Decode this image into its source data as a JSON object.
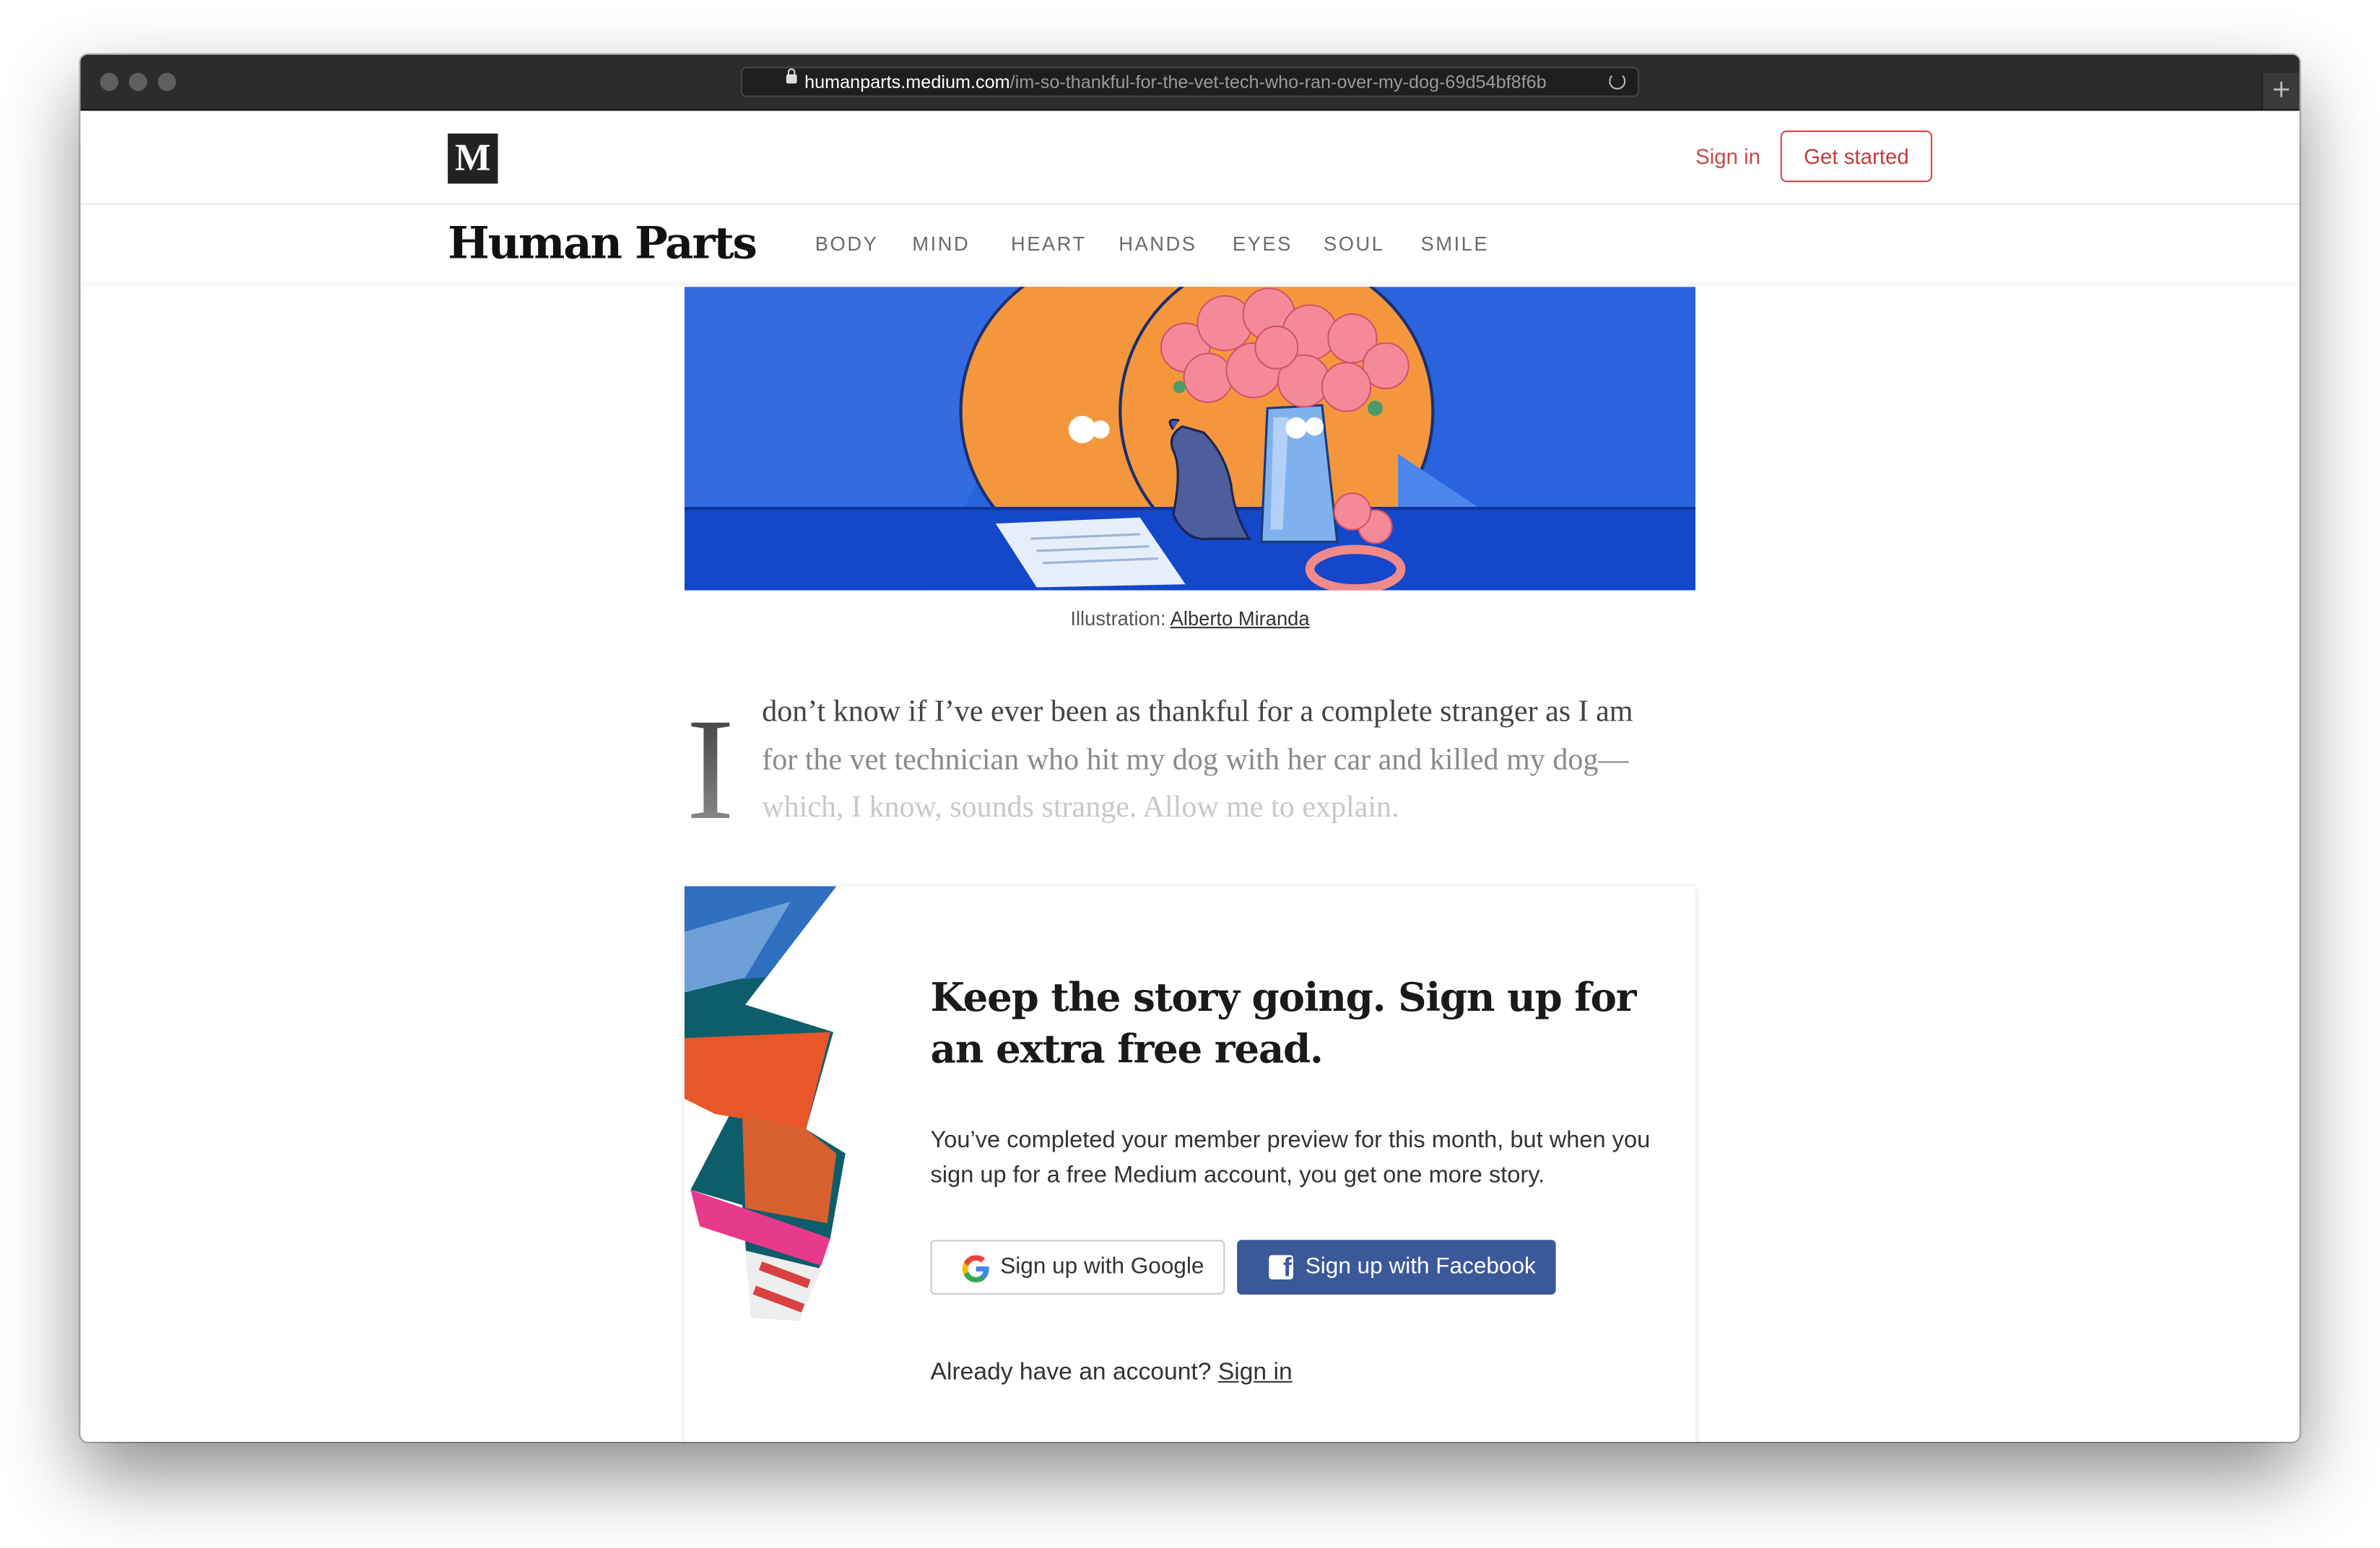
{
  "browser": {
    "url_host": "humanparts.medium.com",
    "url_path": "/im-so-thankful-for-the-vet-tech-who-ran-over-my-dog-69d54bf8f6b",
    "new_tab_label": "+"
  },
  "header": {
    "logo": "M",
    "sign_in": "Sign in",
    "get_started": "Get started"
  },
  "publication": {
    "name": "Human Parts",
    "nav": [
      "BODY",
      "MIND",
      "HEART",
      "HANDS",
      "EYES",
      "SOUL",
      "SMILE"
    ]
  },
  "article": {
    "caption_prefix": "Illustration: ",
    "caption_credit": "Alberto Miranda",
    "drop_cap": "I",
    "lines": [
      "don’t know if I’ve ever been as thankful for a complete stranger as I am",
      "for the vet technician who hit my dog with her car and killed my dog—",
      "which, I know, sounds strange. Allow me to explain."
    ]
  },
  "paywall": {
    "heading": "Keep the story going. Sign up for an extra free read.",
    "body": "You’ve completed your member preview for this month, but when you sign up for a free Medium account, you get one more story.",
    "google_button": "Sign up with Google",
    "facebook_button": "Sign up with Facebook",
    "already_text": "Already have an account? ",
    "sign_in_link": "Sign in"
  },
  "colors": {
    "accent": "#c94a4a",
    "facebook": "#3b5998",
    "hero_blue": "#2a63de"
  }
}
